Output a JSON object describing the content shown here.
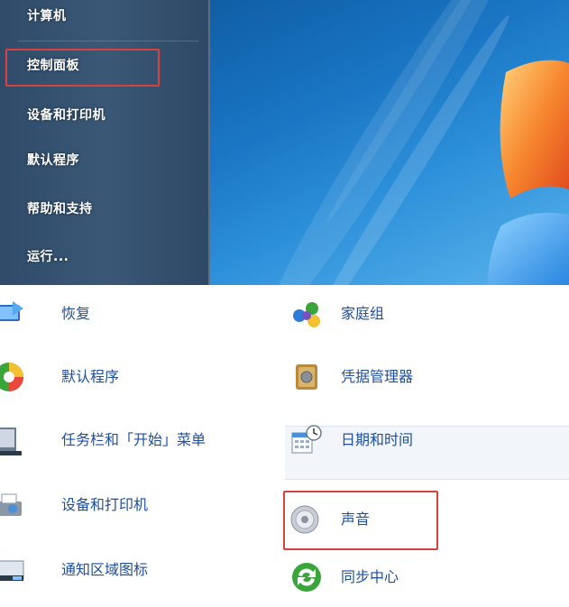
{
  "start_menu": {
    "items": [
      {
        "label": "计算机",
        "icon": "computer"
      },
      {
        "label": "控制面板",
        "icon": "control-panel",
        "highlighted": true
      },
      {
        "label": "设备和打印机",
        "icon": "devices-printers"
      },
      {
        "label": "默认程序",
        "icon": "default-programs"
      },
      {
        "label": "帮助和支持",
        "icon": "help-support"
      },
      {
        "label": "运行...",
        "icon": "run"
      }
    ]
  },
  "control_panel": {
    "left_column": [
      {
        "label": "恢复",
        "icon": "recovery-icon"
      },
      {
        "label": "默认程序",
        "icon": "default-programs-icon"
      },
      {
        "label": "任务栏和「开始」菜单",
        "icon": "taskbar-icon"
      },
      {
        "label": "设备和打印机",
        "icon": "devices-printers-icon"
      },
      {
        "label": "通知区域图标",
        "icon": "notification-area-icon"
      }
    ],
    "right_column": [
      {
        "label": "家庭组",
        "icon": "homegroup-icon"
      },
      {
        "label": "凭据管理器",
        "icon": "credential-manager-icon"
      },
      {
        "label": "日期和时间",
        "icon": "date-time-icon"
      },
      {
        "label": "声音",
        "icon": "sound-icon",
        "highlighted": true
      },
      {
        "label": "同步中心",
        "icon": "sync-center-icon"
      }
    ]
  },
  "colors": {
    "highlight_border": "#d9413f",
    "link_text": "#1f4fa0",
    "menu_background": "#3a5876",
    "desktop_blue": "#1a76c4"
  }
}
